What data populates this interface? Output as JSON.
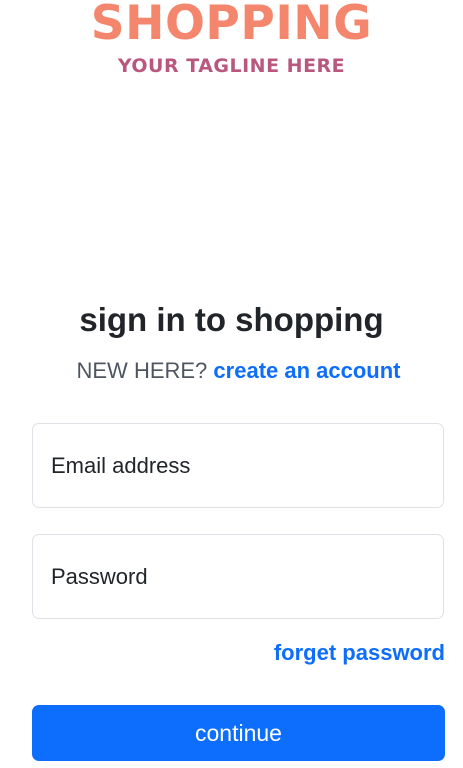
{
  "logo": {
    "title": "SHOPPING",
    "tagline": "YOUR TAGLINE HERE",
    "title_color": "#f4866e",
    "tagline_color": "#b9587c"
  },
  "signin": {
    "heading": "sign in to shopping",
    "new_here": "NEW HERE?",
    "create_account_link": "create an account"
  },
  "form": {
    "email_placeholder": "Email address",
    "email_value": "",
    "password_placeholder": "Password",
    "password_value": "",
    "forget_password_link": "forget password",
    "continue_label": "continue"
  },
  "colors": {
    "accent": "#0d6efd",
    "text": "#212529",
    "muted_text": "#4f5660",
    "field_border": "#dee2e6"
  }
}
